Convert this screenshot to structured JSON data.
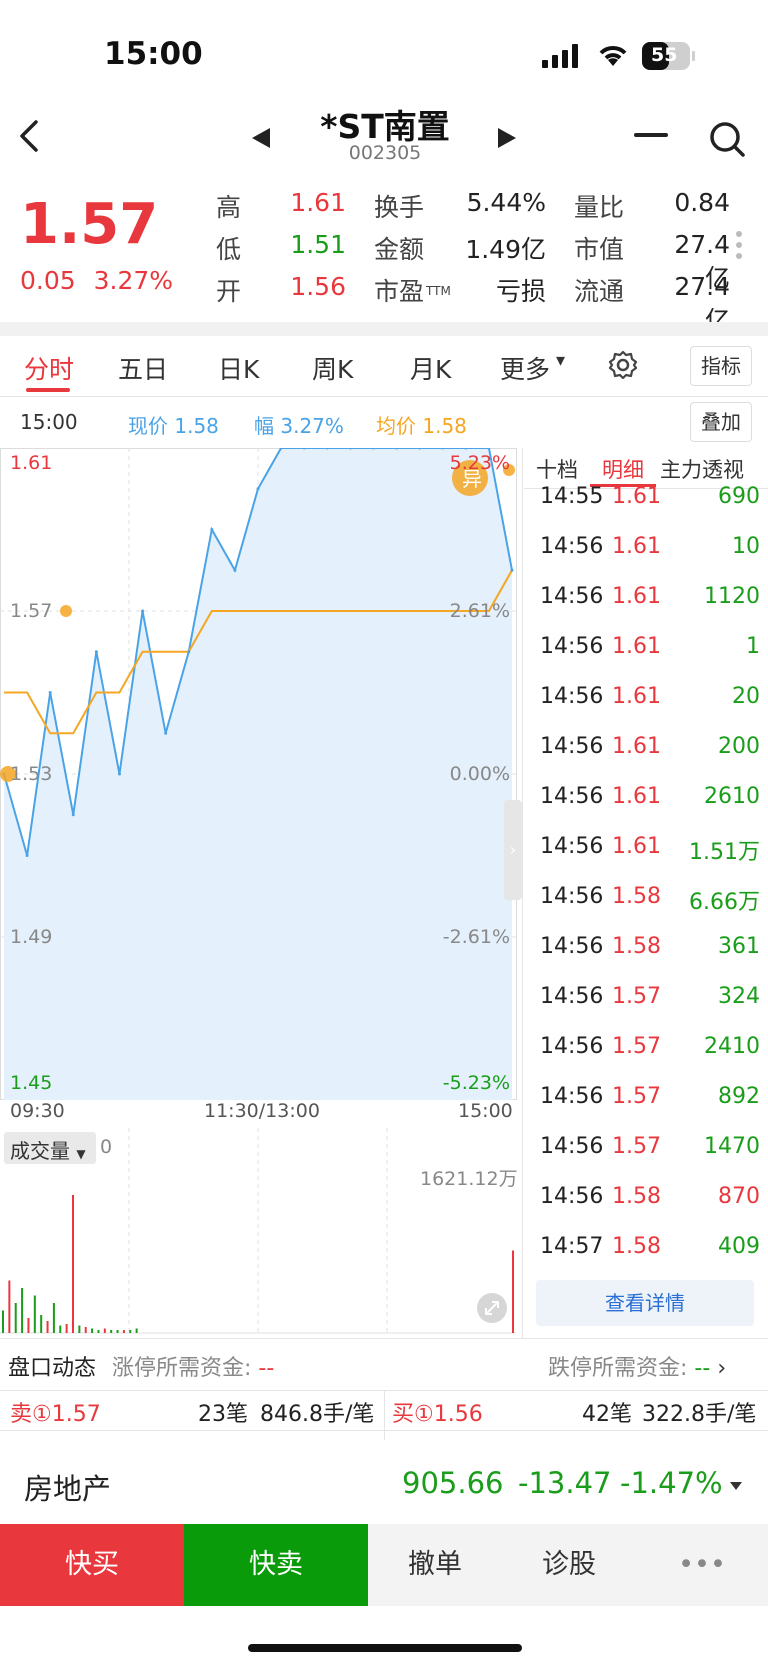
{
  "status_bar": {
    "time": "15:00",
    "battery": "55"
  },
  "header": {
    "title": "*ST南置",
    "code": "002305"
  },
  "quote": {
    "price": "1.57",
    "change": "0.05",
    "change_pct": "3.27%",
    "items": [
      {
        "label": "高",
        "value": "1.61",
        "color": "#e8383d"
      },
      {
        "label": "换手",
        "value": "5.44%",
        "color": "#222222"
      },
      {
        "label": "量比",
        "value": "0.84",
        "color": "#222222"
      },
      {
        "label": "低",
        "value": "1.51",
        "color": "#1a9d1a"
      },
      {
        "label": "金额",
        "value": "1.49亿",
        "color": "#222222"
      },
      {
        "label": "市值",
        "value": "27.4亿",
        "color": "#222222"
      },
      {
        "label": "开",
        "value": "1.56",
        "color": "#e8383d"
      },
      {
        "label": "市盈",
        "label_sub": "TTM",
        "value": "亏损",
        "color": "#222222"
      },
      {
        "label": "流通",
        "value": "27.4亿",
        "color": "#222222"
      }
    ]
  },
  "tabs": {
    "items": [
      "分时",
      "五日",
      "日K",
      "周K",
      "月K",
      "更多"
    ],
    "active": "分时",
    "indicator_button": "指标"
  },
  "info_row": {
    "time": "15:00",
    "now_label": "现价",
    "now_value": "1.58",
    "amp_label": "幅",
    "amp_value": "3.27%",
    "avg_label": "均价",
    "avg_value": "1.58",
    "overlay_button": "叠加"
  },
  "chart_data": {
    "type": "line",
    "y_left_ticks": [
      "1.61",
      "1.57",
      "1.53",
      "1.49",
      "1.45"
    ],
    "y_right_ticks": [
      "5.23%",
      "2.61%",
      "0.00%",
      "-2.61%",
      "-5.23%"
    ],
    "x_ticks": [
      "09:30",
      "11:30/13:00",
      "15:00"
    ],
    "ylim": [
      1.45,
      1.61
    ],
    "series": [
      {
        "name": "现价",
        "color": "#4aa3e6",
        "values": [
          1.53,
          1.51,
          1.55,
          1.52,
          1.56,
          1.53,
          1.57,
          1.54,
          1.56,
          1.59,
          1.58,
          1.6,
          1.61,
          1.61,
          1.61,
          1.61,
          1.61,
          1.61,
          1.61,
          1.61,
          1.61,
          1.61,
          1.58
        ]
      },
      {
        "name": "均价",
        "color": "#f5a623",
        "values": [
          1.55,
          1.55,
          1.54,
          1.54,
          1.55,
          1.55,
          1.56,
          1.56,
          1.56,
          1.57,
          1.57,
          1.57,
          1.57,
          1.57,
          1.57,
          1.57,
          1.57,
          1.57,
          1.57,
          1.57,
          1.57,
          1.57,
          1.58
        ]
      }
    ],
    "anomaly_badge": "异",
    "volume": {
      "label": "成交量",
      "zero": "0",
      "max": "1621.12万",
      "bars": [
        0.15,
        0.35,
        0.2,
        0.3,
        0.1,
        0.25,
        0.12,
        0.08,
        0.2,
        0.05,
        0.06,
        0.92,
        0.05,
        0.04,
        0.03,
        0.02,
        0.03,
        0.02,
        0.02,
        0.02,
        0.02,
        0.03,
        0.55
      ]
    }
  },
  "detail_panel": {
    "tabs": [
      "十档",
      "明细",
      "主力透视"
    ],
    "active": "明细",
    "rows": [
      {
        "time": "14:55",
        "price": "1.61",
        "vol": "690"
      },
      {
        "time": "14:56",
        "price": "1.61",
        "vol": "10"
      },
      {
        "time": "14:56",
        "price": "1.61",
        "vol": "1120"
      },
      {
        "time": "14:56",
        "price": "1.61",
        "vol": "1"
      },
      {
        "time": "14:56",
        "price": "1.61",
        "vol": "20"
      },
      {
        "time": "14:56",
        "price": "1.61",
        "vol": "200"
      },
      {
        "time": "14:56",
        "price": "1.61",
        "vol": "2610"
      },
      {
        "time": "14:56",
        "price": "1.61",
        "vol": "1.51万"
      },
      {
        "time": "14:56",
        "price": "1.58",
        "vol": "6.66万"
      },
      {
        "time": "14:56",
        "price": "1.58",
        "vol": "361"
      },
      {
        "time": "14:56",
        "price": "1.57",
        "vol": "324"
      },
      {
        "time": "14:56",
        "price": "1.57",
        "vol": "2410"
      },
      {
        "time": "14:56",
        "price": "1.57",
        "vol": "892"
      },
      {
        "time": "14:56",
        "price": "1.57",
        "vol": "1470"
      },
      {
        "time": "14:56",
        "price": "1.58",
        "vol": "870"
      },
      {
        "time": "14:57",
        "price": "1.58",
        "vol": "409"
      }
    ],
    "vol_colors": [
      "green",
      "green",
      "green",
      "green",
      "green",
      "green",
      "green",
      "green",
      "green",
      "green",
      "green",
      "green",
      "green",
      "green",
      "red",
      "green"
    ],
    "detail_button": "查看详情"
  },
  "order_book": {
    "title": "盘口动态",
    "limit_up_label": "涨停所需资金:",
    "limit_up_value": "--",
    "limit_down_label": "跌停所需资金:",
    "limit_down_value": "--",
    "sell1": "卖①1.57",
    "sell1_count": "23笔",
    "sell1_avg": "846.8手/笔",
    "buy1": "买①1.56",
    "buy1_count": "42笔",
    "buy1_avg": "322.8手/笔"
  },
  "sector": {
    "name": "房地产",
    "value": "905.66",
    "change": "-13.47",
    "change_pct": "-1.47%"
  },
  "actions": {
    "buy": "快买",
    "sell": "快卖",
    "cancel": "撤单",
    "diagnose": "诊股",
    "more": "•••"
  },
  "colors": {
    "up": "#e8383d",
    "down": "#1a9d1a",
    "price_line": "#4aa3e6",
    "avg_line": "#f5a623",
    "fill": "#e4f0fb"
  }
}
